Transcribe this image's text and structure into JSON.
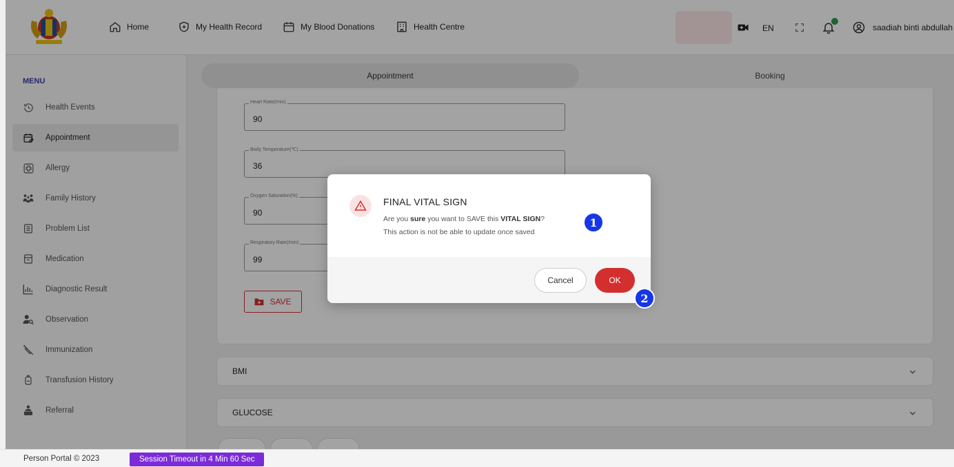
{
  "header": {
    "nav": [
      {
        "label": "Home",
        "icon": "home-icon"
      },
      {
        "label": "My Health Record",
        "icon": "shield-plus-icon"
      },
      {
        "label": "My Blood Donations",
        "icon": "calendar-icon"
      },
      {
        "label": "Health Centre",
        "icon": "building-icon"
      }
    ],
    "language": "EN",
    "user_name": "saadiah binti abdullah"
  },
  "sidebar": {
    "title": "MENU",
    "items": [
      {
        "label": "Health Events",
        "icon": "history-icon"
      },
      {
        "label": "Appointment",
        "icon": "calendar-edit-icon",
        "active": true
      },
      {
        "label": "Allergy",
        "icon": "medical-cross-icon"
      },
      {
        "label": "Family History",
        "icon": "family-icon"
      },
      {
        "label": "Problem List",
        "icon": "list-icon"
      },
      {
        "label": "Medication",
        "icon": "medication-icon"
      },
      {
        "label": "Diagnostic Result",
        "icon": "bar-chart-icon"
      },
      {
        "label": "Observation",
        "icon": "observation-icon"
      },
      {
        "label": "Immunization",
        "icon": "syringe-icon"
      },
      {
        "label": "Transfusion History",
        "icon": "blood-bag-icon"
      },
      {
        "label": "Referral",
        "icon": "referral-icon"
      }
    ]
  },
  "tabs": {
    "appointment": "Appointment",
    "booking": "Booking"
  },
  "vitals": {
    "heart_rate_label": "Heart Rate(/min)",
    "heart_rate_value": "90",
    "body_temp_label": "Body Temperature(℃)",
    "body_temp_value": "36",
    "oxygen_label": "Oxygen Saturation(%)",
    "oxygen_value": "90",
    "resp_label": "Respiratory Rate(/min)",
    "resp_value": "99",
    "save_label": "SAVE"
  },
  "accordions": {
    "bmi": "BMI",
    "glucose": "GLUCOSE"
  },
  "dialog": {
    "title": "FINAL VITAL SIGN",
    "msg_part1": "Are you ",
    "msg_bold1": "sure",
    "msg_part2": " you want to SAVE this ",
    "msg_bold2": "VITAL SIGN",
    "msg_part3": "?",
    "msg_line2": "This action is not be able to update once saved",
    "cancel_label": "Cancel",
    "ok_label": "OK"
  },
  "markers": {
    "one": "1",
    "two": "2"
  },
  "footer": {
    "copyright": "Person Portal © 2023",
    "session": "Session Timeout in 4 Min 60 Sec"
  },
  "colors": {
    "accent_red": "#d32f2f",
    "menu_title": "#3b3fa8",
    "session_bg": "#7c2bd9",
    "marker_blue": "#1736e6",
    "notification_green": "#2e9e4b"
  }
}
